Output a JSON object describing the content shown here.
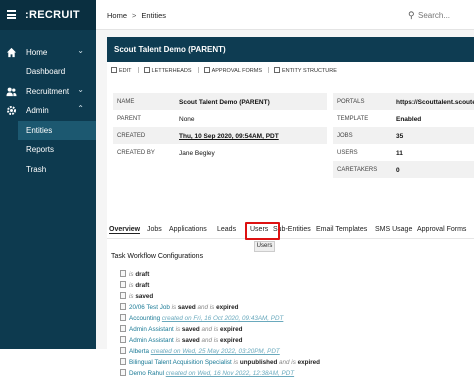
{
  "app": {
    "brand": ":RECRUIT"
  },
  "sidebar": {
    "items": [
      {
        "label": "Home",
        "icon": "home-icon"
      },
      {
        "label": "Dashboard"
      },
      {
        "label": "Recruitment",
        "icon": "people-icon"
      },
      {
        "label": "Admin",
        "icon": "gear-icon"
      },
      {
        "label": "Entities",
        "selected": true
      },
      {
        "label": "Reports"
      },
      {
        "label": "Trash"
      }
    ]
  },
  "topbar": {
    "breadcrumb": [
      "Home",
      "Entities"
    ],
    "search_placeholder": "Search..."
  },
  "card": {
    "title": "Scout Talent Demo (PARENT)",
    "actions": [
      "EDIT",
      "LETTERHEADS",
      "APPROVAL FORMS",
      "ENTITY STRUCTURE"
    ],
    "details_left": [
      {
        "key": "NAME",
        "value": "Scout Talent Demo (PARENT)"
      },
      {
        "key": "PARENT",
        "value": "None"
      },
      {
        "key": "CREATED",
        "value": "Thu, 10 Sep 2020, 09:54AM, PDT"
      },
      {
        "key": "CREATED BY",
        "value": "Jane Begley"
      }
    ],
    "details_right": [
      {
        "key": "PORTALS",
        "value": "https://Scouttalent.scouten"
      },
      {
        "key": "TEMPLATE",
        "value": "Enabled"
      },
      {
        "key": "JOBS",
        "value": "35"
      },
      {
        "key": "USERS",
        "value": "11"
      },
      {
        "key": "CARETAKERS",
        "value": "0"
      }
    ],
    "tabs": [
      "Overview",
      "Jobs",
      "Applications",
      "Leads",
      "Users",
      "Sub-Entities",
      "Email Templates",
      "SMS Usage",
      "Approval Forms"
    ],
    "active_tab": "Overview",
    "highlighted_tab": "Users",
    "tooltip": "Users",
    "workflow_title": "Task Workflow Configurations",
    "workflows": [
      {
        "name": "",
        "is": "is",
        "status": "draft"
      },
      {
        "name": "",
        "is": "is",
        "status": "draft"
      },
      {
        "name": "",
        "is": "is",
        "status": "saved"
      },
      {
        "name": "20/06 Test Job",
        "is": "is",
        "status": "saved",
        "mid": "and is",
        "status2": "expired"
      },
      {
        "name": "Accounting",
        "date": "created on Fri, 16 Oct 2020, 09:43AM, PDT"
      },
      {
        "name": "Admin Assistant",
        "is": "is",
        "status": "saved",
        "mid": "and is",
        "status2": "expired"
      },
      {
        "name": "Admin Assistant",
        "is": "is",
        "status": "saved",
        "mid": "and is",
        "status2": "expired"
      },
      {
        "name": "Alberta",
        "date": "created on Wed, 25 May 2022, 03:20PM, PDT"
      },
      {
        "name": "Bilingual Talent Acquisition Specialist",
        "is": "is",
        "status": "unpublished",
        "mid": "and is",
        "status2": "expired"
      },
      {
        "name": "Demo Rahul",
        "date": "created on Wed, 16 Nov 2022, 12:38AM, PDT"
      }
    ]
  }
}
